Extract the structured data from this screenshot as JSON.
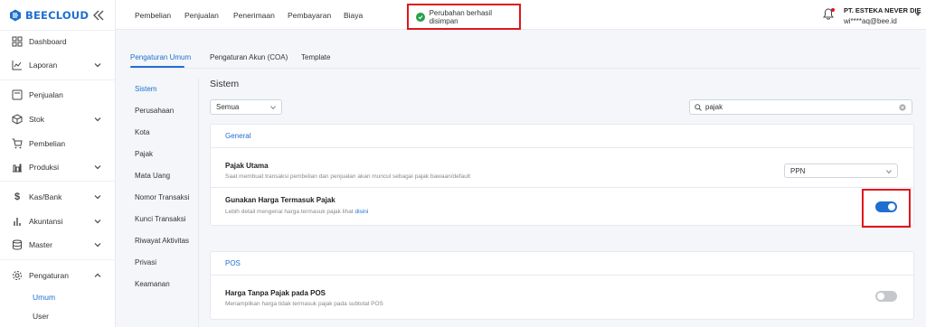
{
  "app": {
    "logo_text": "BEECLOUD"
  },
  "sidebar": {
    "items": [
      {
        "label": "Dashboard",
        "icon": "dashboard-icon"
      },
      {
        "label": "Laporan",
        "icon": "chart-line-icon",
        "expandable": true
      },
      {
        "label": "Penjualan",
        "icon": "sales-icon"
      },
      {
        "label": "Stok",
        "icon": "box-icon",
        "expandable": true
      },
      {
        "label": "Pembelian",
        "icon": "cart-icon"
      },
      {
        "label": "Produksi",
        "icon": "factory-icon",
        "expandable": true
      },
      {
        "label": "Kas/Bank",
        "icon": "dollar-icon",
        "expandable": true
      },
      {
        "label": "Akuntansi",
        "icon": "bar-chart-icon",
        "expandable": true
      },
      {
        "label": "Master",
        "icon": "database-icon",
        "expandable": true
      },
      {
        "label": "Pengaturan",
        "icon": "gear-icon",
        "expandable": true,
        "expanded": true
      }
    ],
    "subitems": [
      {
        "label": "Umum",
        "active": true
      },
      {
        "label": "User",
        "active": false
      }
    ]
  },
  "topbar": {
    "menu": [
      "Pembelian",
      "Penjualan",
      "Penerimaan",
      "Pembayaran",
      "Biaya"
    ],
    "toast": "Perubahan berhasil disimpan",
    "company": "PT. ESTEKA NEVER DIE",
    "email": "wi****aq@bee.id"
  },
  "tabs": [
    {
      "label": "Pengaturan Umum",
      "active": true
    },
    {
      "label": "Pengaturan Akun (COA)",
      "active": false
    },
    {
      "label": "Template",
      "active": false
    }
  ],
  "subnav": [
    {
      "label": "Sistem",
      "active": true
    },
    {
      "label": "Perusahaan"
    },
    {
      "label": "Kota"
    },
    {
      "label": "Pajak"
    },
    {
      "label": "Mata Uang"
    },
    {
      "label": "Nomor Transaksi"
    },
    {
      "label": "Kunci Transaksi"
    },
    {
      "label": "Riwayat Aktivitas"
    },
    {
      "label": "Privasi"
    },
    {
      "label": "Keamanan"
    }
  ],
  "content": {
    "title": "Sistem",
    "filter_value": "Semua",
    "search_value": "pajak",
    "general": {
      "header": "General",
      "pajak_utama": {
        "title": "Pajak Utama",
        "desc": "Saat membuat transaksi pembelian dan penjualan akan muncul sebagai pajak bawaan/default",
        "value": "PPN"
      },
      "harga_termasuk_pajak": {
        "title": "Gunakan Harga Termasuk Pajak",
        "desc": "Lebih detail mengenai harga termasuk pajak lihat ",
        "link": "disini",
        "enabled": true
      }
    },
    "pos": {
      "header": "POS",
      "harga_tanpa_pajak": {
        "title": "Harga Tanpa Pajak pada POS",
        "desc": "Menampilkan harga tidak termasuk pajak pada subtotal POS",
        "enabled": false
      }
    }
  },
  "colors": {
    "accent": "#1f6fd1",
    "highlight": "#e0161c",
    "success": "#26a247"
  }
}
